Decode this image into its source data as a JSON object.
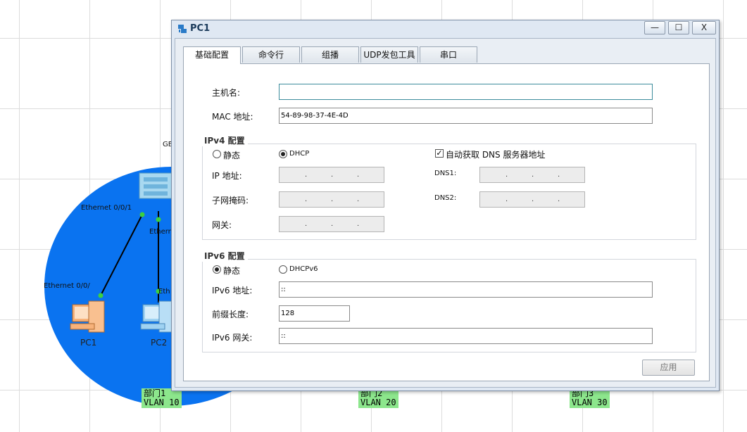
{
  "topology": {
    "link_labels": [
      "Ethernet 0/0/1",
      "Ethernet 0/0/",
      "Etherr",
      "Eth",
      "GE"
    ],
    "devices": [
      "PC1",
      "PC2"
    ],
    "vlan_tags": [
      {
        "top": "部门1",
        "bottom": "VLAN 10"
      },
      {
        "top": "部门2",
        "bottom": "VLAN 20"
      },
      {
        "top": "部门3",
        "bottom": "VLAN 30"
      }
    ],
    "region_color": "#0a73f0",
    "tag_color": "#8ce68c"
  },
  "window": {
    "title": "PC1",
    "minimize": "—",
    "maximize": "☐",
    "close": "X"
  },
  "tabs": [
    "基础配置",
    "命令行",
    "组播",
    "UDP发包工具",
    "串口"
  ],
  "active_tab": "基础配置",
  "basic": {
    "hostname_label": "主机名:",
    "hostname_value": "",
    "mac_label": "MAC 地址:",
    "mac_value": "54-89-98-37-4E-4D",
    "ipv4": {
      "title": "IPv4 配置",
      "static_label": "静态",
      "dhcp_label": "DHCP",
      "selected": "DHCP",
      "auto_dns_label": "自动获取 DNS 服务器地址",
      "auto_dns_checked": true,
      "ip_label": "IP 地址:",
      "mask_label": "子网掩码:",
      "gateway_label": "网关:",
      "dns1_label": "DNS1:",
      "dns2_label": "DNS2:",
      "empty_ip": ".   .   ."
    },
    "ipv6": {
      "title": "IPv6 配置",
      "static_label": "静态",
      "dhcp_label": "DHCPv6",
      "selected": "静态",
      "ip_label": "IPv6 地址:",
      "ip_value": "::",
      "prefix_label": "前缀长度:",
      "prefix_value": "128",
      "gateway_label": "IPv6 网关:",
      "gateway_value": "::"
    },
    "apply_label": "应用"
  }
}
